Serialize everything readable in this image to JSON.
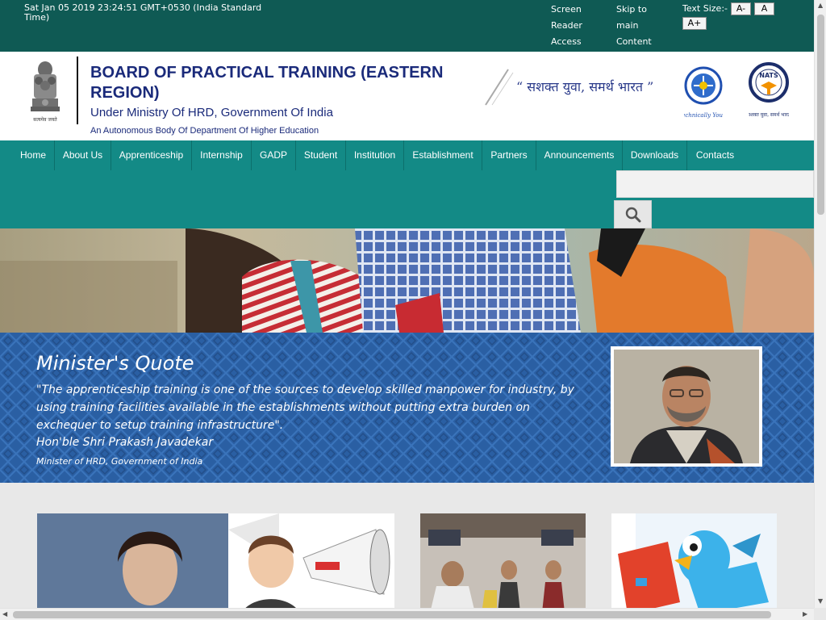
{
  "topbar": {
    "datetime": "Sat Jan 05 2019 23:24:51 GMT+0530 (India Standard Time)",
    "screen_reader": "Screen Reader Access",
    "skip_main": "Skip to main Content",
    "text_size_label": "Text Size:-",
    "ts_minus": "A-",
    "ts_normal": "A",
    "ts_plus": "A+"
  },
  "header": {
    "title": "BOARD OF PRACTICAL TRAINING (EASTERN REGION)",
    "subtitle": "Under Ministry Of HRD, Government Of India",
    "subtitle2": "An Autonomous Body Of Department Of Higher Education",
    "emblem_caption": "सत्यमेव जयते",
    "slogan": "“ सशक्त युवा, समर्थ भारत ”",
    "logo_round_caption": "Technically Yours",
    "logo_nats_text": "NATS",
    "logo_nats_caption": "सशक्त युवा, समर्थ भारत"
  },
  "nav": {
    "items": [
      "Home",
      "About Us",
      "Apprenticeship",
      "Internship",
      "GADP",
      "Student",
      "Institution",
      "Establishment",
      "Partners",
      "Announcements",
      "Downloads",
      "Contacts"
    ]
  },
  "search": {
    "icon": "search-icon"
  },
  "quote": {
    "title": "Minister's Quote",
    "text": "\"The apprenticeship training is one of the sources to develop skilled manpower for industry, by using training facilities available in the establishments without putting extra burden on exchequer to setup training infrastructure\".",
    "author": "Hon'ble Shri Prakash Javadekar",
    "role": "Minister of HRD, Government of India"
  },
  "colors": {
    "topbar": "#0f5a54",
    "nav": "#138a86",
    "title": "#1a2a7a",
    "quote_bg": "#2a5fa3"
  }
}
